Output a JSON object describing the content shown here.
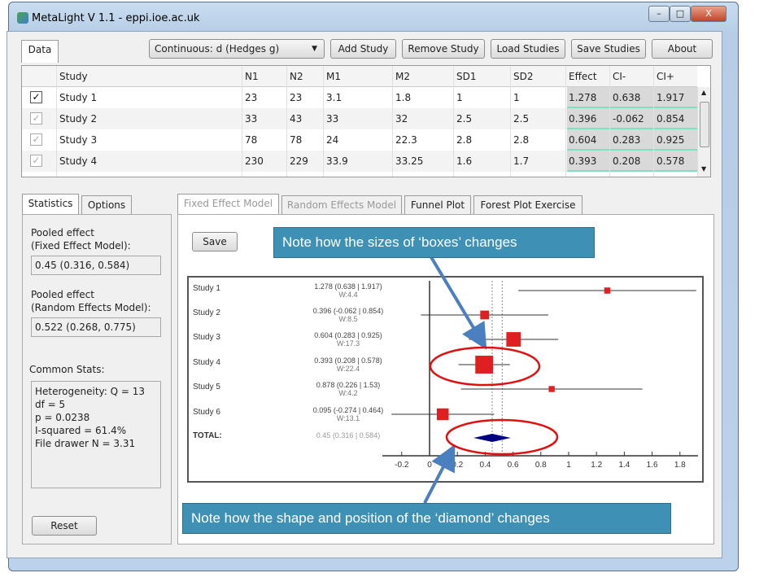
{
  "window": {
    "title": "MetaLight V 1.1 - eppi.ioe.ac.uk",
    "minimize": "–",
    "maximize": "□",
    "close": "X"
  },
  "toolbar": {
    "data_tab": "Data",
    "model_select": "Continuous: d (Hedges g)",
    "add": "Add Study",
    "remove": "Remove Study",
    "load": "Load Studies",
    "save": "Save Studies",
    "about": "About"
  },
  "table": {
    "headers": [
      "Study",
      "N1",
      "N2",
      "M1",
      "M2",
      "SD1",
      "SD2",
      "Effect",
      "CI-",
      "CI+"
    ],
    "rows": [
      [
        "Study 1",
        "23",
        "23",
        "3.1",
        "1.8",
        "1",
        "1",
        "1.278",
        "0.638",
        "1.917"
      ],
      [
        "Study 2",
        "33",
        "43",
        "33",
        "32",
        "2.5",
        "2.5",
        "0.396",
        "-0.062",
        "0.854"
      ],
      [
        "Study 3",
        "78",
        "78",
        "24",
        "22.3",
        "2.8",
        "2.8",
        "0.604",
        "0.283",
        "0.925"
      ],
      [
        "Study 4",
        "230",
        "229",
        "33.9",
        "33.25",
        "1.6",
        "1.7",
        "0.393",
        "0.208",
        "0.578"
      ]
    ],
    "checked": [
      true,
      false,
      false,
      false
    ]
  },
  "left": {
    "tabs": [
      "Statistics",
      "Options"
    ],
    "fixed_label1": "Pooled effect",
    "fixed_label2": "(Fixed Effect Model):",
    "fixed_value": "0.45 (0.316, 0.584)",
    "random_label1": "Pooled effect",
    "random_label2": "(Random Effects Model):",
    "random_value": "0.522 (0.268, 0.775)",
    "common_label": "Common Stats:",
    "stats": [
      "Heterogeneity: Q = 13",
      "df = 5",
      "p = 0.0238",
      "I-squared = 61.4%",
      "File drawer N = 3.31"
    ],
    "reset": "Reset"
  },
  "right": {
    "tabs": [
      "Fixed Effect Model",
      "Random Effects Model",
      "Funnel Plot",
      "Forest Plot Exercise"
    ],
    "save": "Save"
  },
  "chart_data": {
    "type": "forest",
    "xlim": [
      -0.2,
      1.9
    ],
    "xticks": [
      "-0.2",
      "0",
      "0.2",
      "0.4",
      "0.6",
      "0.8",
      "1",
      "1.2",
      "1.4",
      "1.6",
      "1.8"
    ],
    "studies": [
      {
        "name": "Study 1",
        "effect": 1.278,
        "lo": 0.638,
        "hi": 1.917,
        "label": "1.278 (0.638 | 1.917)",
        "weight": "W:4.4"
      },
      {
        "name": "Study 2",
        "effect": 0.396,
        "lo": -0.062,
        "hi": 0.854,
        "label": "0.396 (-0.062 | 0.854)",
        "weight": "W:8.5"
      },
      {
        "name": "Study 3",
        "effect": 0.604,
        "lo": 0.283,
        "hi": 0.925,
        "label": "0.604 (0.283 | 0.925)",
        "weight": "W:17.3"
      },
      {
        "name": "Study 4",
        "effect": 0.393,
        "lo": 0.208,
        "hi": 0.578,
        "label": "0.393 (0.208 | 0.578)",
        "weight": "W:22.4"
      },
      {
        "name": "Study 5",
        "effect": 0.878,
        "lo": 0.226,
        "hi": 1.53,
        "label": "0.878 (0.226 | 1.53)",
        "weight": "W:4.2"
      },
      {
        "name": "Study 6",
        "effect": 0.095,
        "lo": -0.274,
        "hi": 0.464,
        "label": "0.095 (-0.274 | 0.464)",
        "weight": "W:13.1"
      }
    ],
    "total": {
      "name": "TOTAL:",
      "effect": 0.45,
      "lo": 0.316,
      "hi": 0.584,
      "label": "0.45 (0.316 | 0.584)"
    },
    "reference_lines": [
      0.45,
      0.522
    ],
    "box_color": "#e02020",
    "diamond_color": "#000080"
  },
  "annotations": {
    "boxes": "Note how the sizes of ‘boxes’ changes",
    "diamond": "Note how the shape and position of the ‘diamond’ changes",
    "color": "#3e90b4"
  }
}
